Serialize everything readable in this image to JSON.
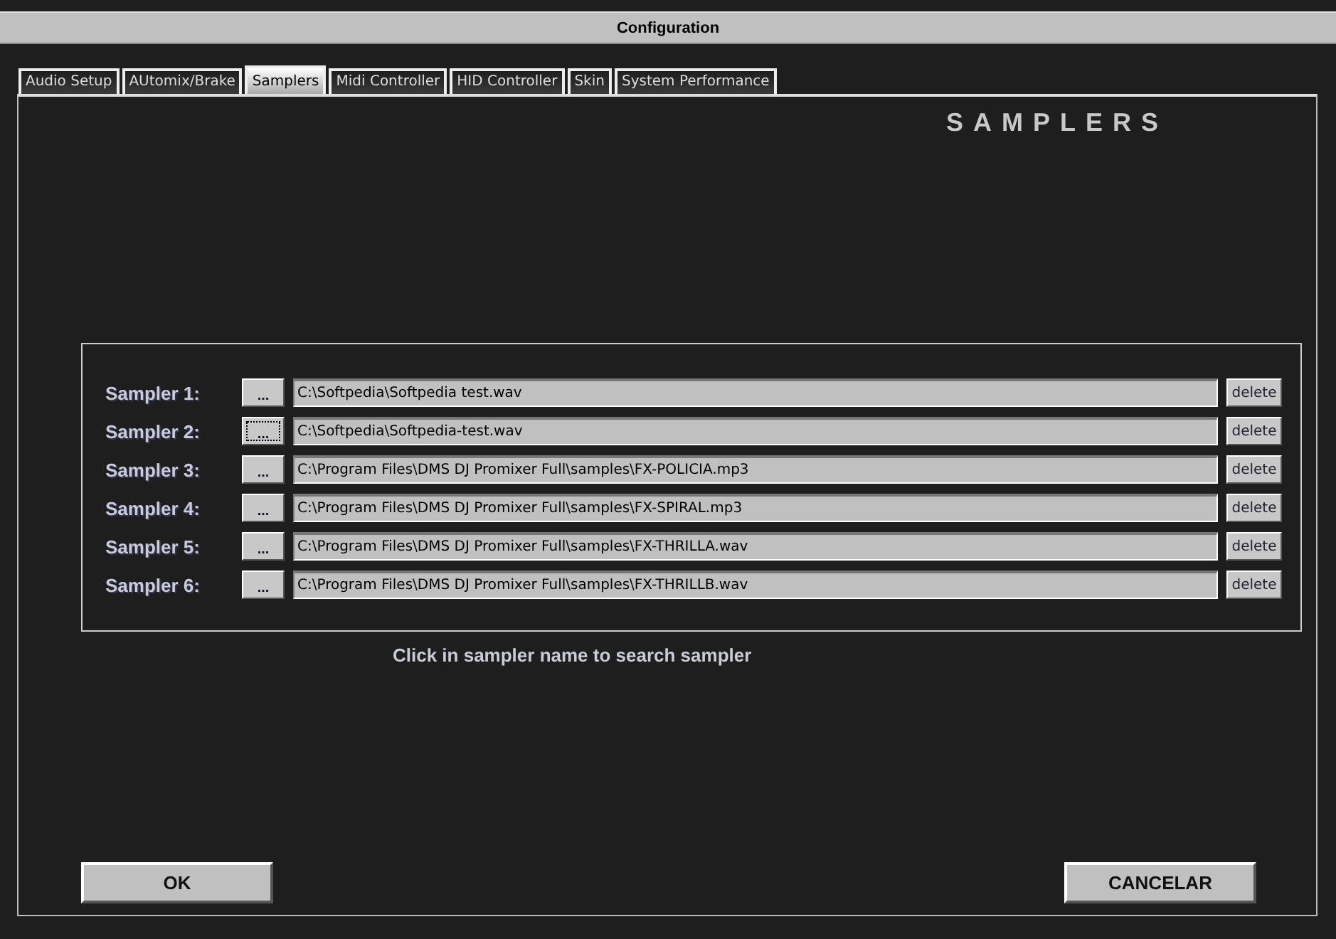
{
  "window": {
    "title": "Configuration"
  },
  "tabs": [
    {
      "label": "Audio Setup",
      "selected": false
    },
    {
      "label": "AUtomix/Brake",
      "selected": false
    },
    {
      "label": "Samplers",
      "selected": true
    },
    {
      "label": "Midi Controller",
      "selected": false
    },
    {
      "label": "HID Controller",
      "selected": false
    },
    {
      "label": "Skin",
      "selected": false
    },
    {
      "label": "System Performance",
      "selected": false
    }
  ],
  "heading": "SAMPLERS",
  "samplers": [
    {
      "label": "Sampler 1:",
      "browse": "...",
      "focused": false,
      "path": "C:\\Softpedia\\Softpedia test.wav",
      "delete": "delete"
    },
    {
      "label": "Sampler 2:",
      "browse": "...",
      "focused": true,
      "path": "C:\\Softpedia\\Softpedia-test.wav",
      "delete": "delete"
    },
    {
      "label": "Sampler 3:",
      "browse": "...",
      "focused": false,
      "path": "C:\\Program Files\\DMS DJ Promixer Full\\samples\\FX-POLICIA.mp3",
      "delete": "delete"
    },
    {
      "label": "Sampler 4:",
      "browse": "...",
      "focused": false,
      "path": "C:\\Program Files\\DMS DJ Promixer Full\\samples\\FX-SPIRAL.mp3",
      "delete": "delete"
    },
    {
      "label": "Sampler 5:",
      "browse": "...",
      "focused": false,
      "path": "C:\\Program Files\\DMS DJ Promixer Full\\samples\\FX-THRILLA.wav",
      "delete": "delete"
    },
    {
      "label": "Sampler 6:",
      "browse": "...",
      "focused": false,
      "path": "C:\\Program Files\\DMS DJ Promixer Full\\samples\\FX-THRILLB.wav",
      "delete": "delete"
    }
  ],
  "hint": "Click in sampler name to search sampler",
  "buttons": {
    "ok": "OK",
    "cancel": "CANCELAR"
  }
}
